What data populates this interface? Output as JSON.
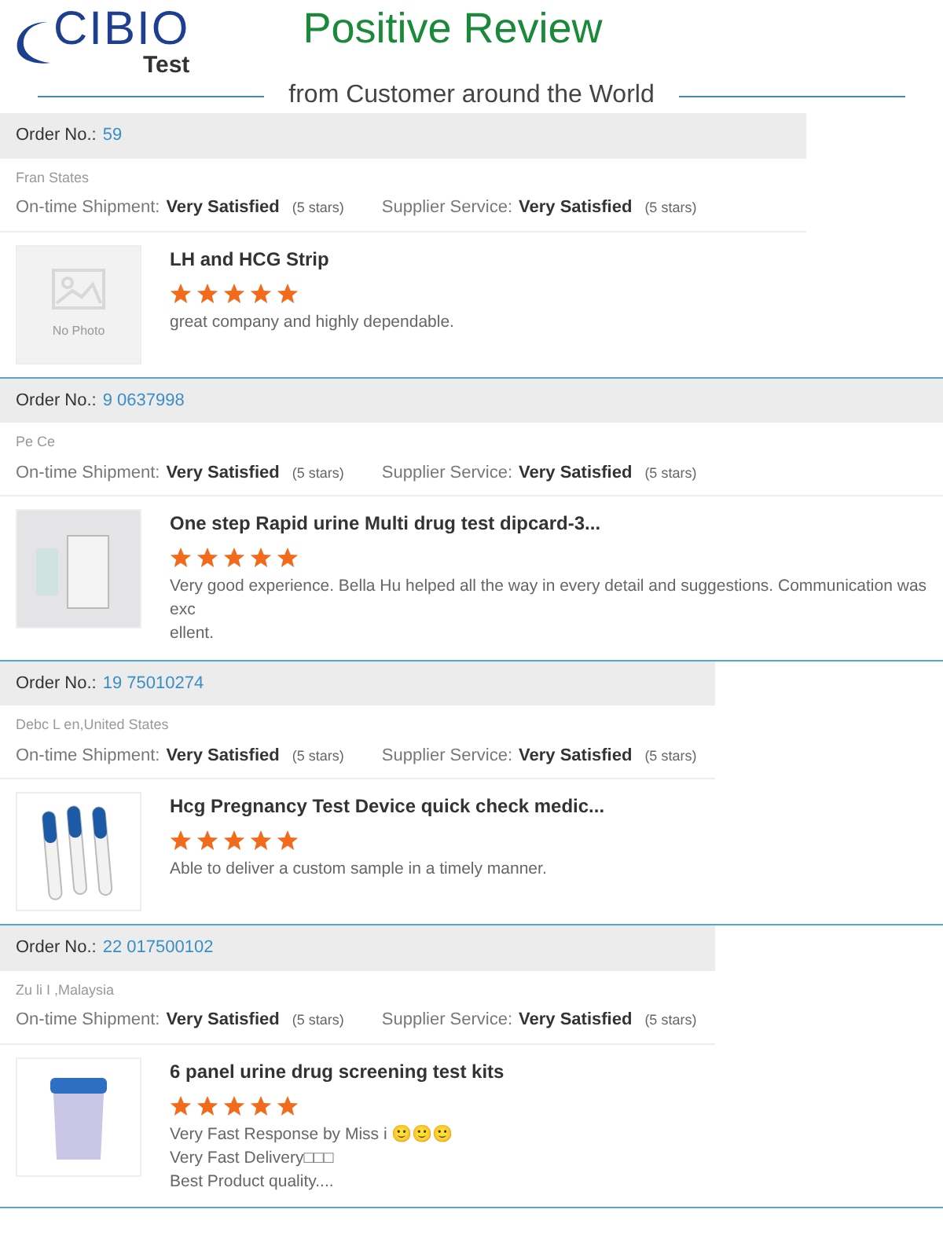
{
  "header": {
    "logo_text": "CIBIO",
    "logo_sub": "Test",
    "title": "Positive Review",
    "subtitle": "from Customer around the World"
  },
  "reviews": [
    {
      "order_label": "Order No.:",
      "order_no": "59",
      "customer": "Fran States",
      "shipment_label": "On-time Shipment:",
      "shipment_value": "Very Satisfied",
      "shipment_stars": "(5 stars)",
      "service_label": "Supplier Service:",
      "service_value": "Very Satisfied",
      "service_stars": "(5 stars)",
      "kind": "none",
      "photo_label": "No Photo",
      "product": "LH and HCG Strip",
      "stars": 5,
      "comment": [
        "great company and highly dependable."
      ]
    },
    {
      "order_label": "Order No.:",
      "order_no": "9 0637998",
      "customer": "Pe Ce",
      "shipment_label": "On-time Shipment:",
      "shipment_value": "Very Satisfied",
      "shipment_stars": "(5 stars)",
      "service_label": "Supplier Service:",
      "service_value": "Very Satisfied",
      "service_stars": "(5 stars)",
      "kind": "dipcard",
      "product": "One step Rapid urine Multi drug test dipcard-3...",
      "stars": 5,
      "comment": [
        "Very good experience. Bella Hu helped all the way in every detail and suggestions. Communication was exc",
        "ellent."
      ]
    },
    {
      "order_label": "Order No.:",
      "order_no": "19 75010274",
      "customer": "Debc L en,United States",
      "shipment_label": "On-time Shipment:",
      "shipment_value": "Very Satisfied",
      "shipment_stars": "(5 stars)",
      "service_label": "Supplier Service:",
      "service_value": "Very Satisfied",
      "service_stars": "(5 stars)",
      "kind": "pregnancy",
      "product": "Hcg Pregnancy Test Device quick check medic...",
      "stars": 5,
      "comment": [
        "Able to deliver a custom sample in a timely manner."
      ]
    },
    {
      "order_label": "Order No.:",
      "order_no": "22 017500102",
      "customer": "Zu li I ,Malaysia",
      "shipment_label": "On-time Shipment:",
      "shipment_value": "Very Satisfied",
      "shipment_stars": "(5 stars)",
      "service_label": "Supplier Service:",
      "service_value": "Very Satisfied",
      "service_stars": "(5 stars)",
      "kind": "cup",
      "product": "6 panel urine drug screening test kits",
      "stars": 5,
      "comment": [
        "Very Fast Response by  Miss  i 🙂🙂🙂",
        "Very Fast Delivery□□□",
        "Best Product quality...."
      ]
    }
  ]
}
